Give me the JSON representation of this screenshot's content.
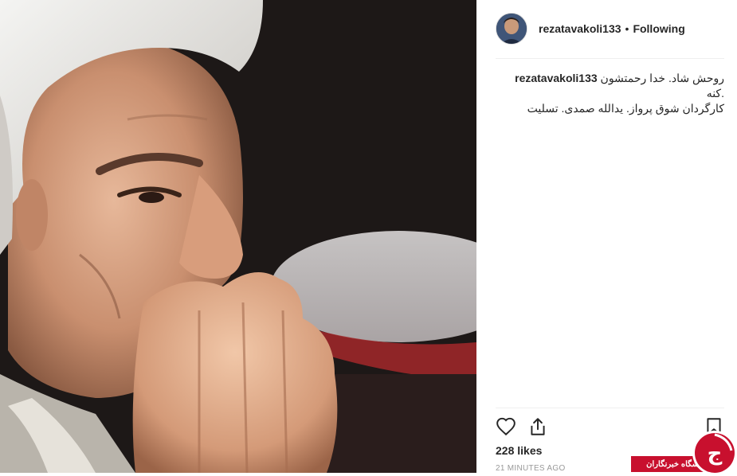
{
  "post": {
    "username": "rezatavakoli133",
    "separator": "•",
    "follow_status": "Following",
    "caption_text_1": "روحش شاد. خدا رحمتشون کنه.",
    "caption_text_2": "کارگردان شوق پرواز. یدالله صمدی. تسلیت",
    "likes": "228 likes",
    "time_ago": "21 MINUTES AGO"
  },
  "photo": {
    "subject": "portrait of grey-haired man with hands clasped"
  },
  "icons": {
    "like": "heart-icon",
    "share": "share-icon",
    "save": "bookmark-icon"
  },
  "watermark": {
    "label": "باشگاه خبرنگاران",
    "logo_letter": "ج"
  },
  "colors": {
    "text": "#262626",
    "muted": "#999999",
    "divider": "#efefef",
    "watermark_red": "#c8102e"
  }
}
